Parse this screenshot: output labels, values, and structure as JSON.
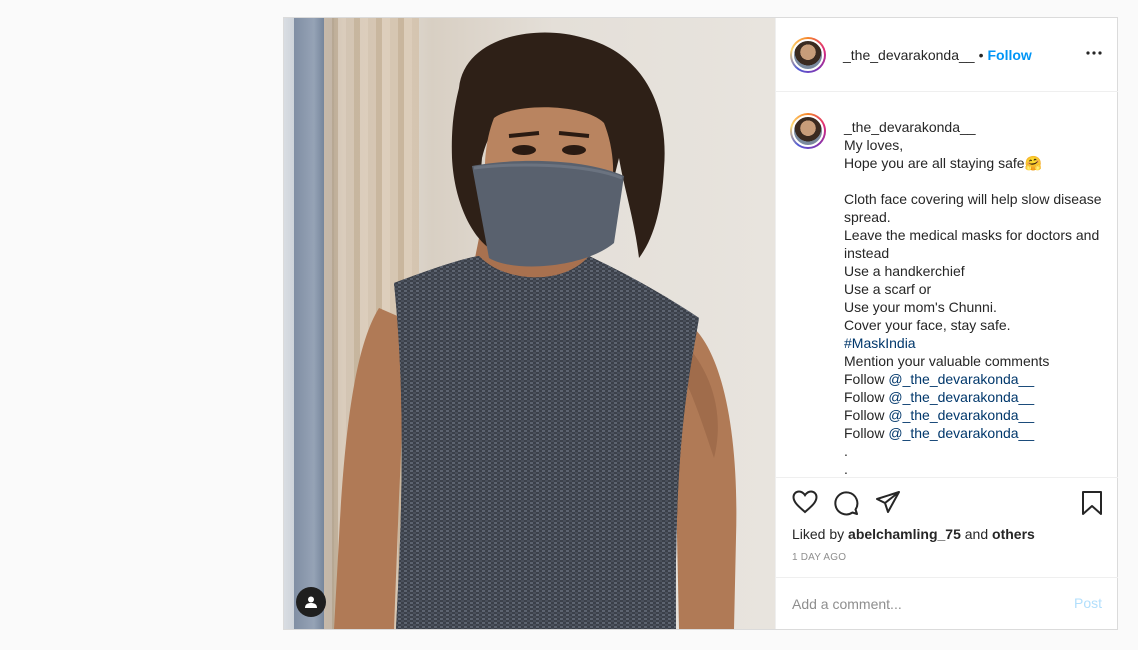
{
  "header": {
    "username": "_the_devarakonda__",
    "separator": "•",
    "follow_label": "Follow",
    "more_icon": "more-horizontal-icon"
  },
  "caption": {
    "username": "_the_devarakonda__",
    "lines": [
      "My loves,",
      "Hope you are all staying safe",
      "",
      "Cloth face covering will help slow disease spread.",
      "Leave the medical masks for doctors and instead",
      "Use a handkerchief",
      "Use a scarf or",
      "Use your mom's Chunni.",
      "Cover your face, stay safe."
    ],
    "emoji": "🤗",
    "hashtag": "#MaskIndia",
    "mention_prompt": "Mention your valuable comments",
    "follow_prefix": "Follow ",
    "follow_mention": "@_the_devarakonda__",
    "dots": "."
  },
  "actions": {
    "icons": [
      "heart-icon",
      "comment-icon",
      "share-icon",
      "bookmark-icon"
    ],
    "liked_prefix": "Liked by ",
    "liked_user": "abelchamling_75",
    "liked_and": " and ",
    "liked_others": "others",
    "timestamp": "1 DAY AGO"
  },
  "comment": {
    "placeholder": "Add a comment...",
    "post_label": "Post"
  },
  "colors": {
    "accent": "#0095f6",
    "link": "#00376b",
    "muted": "#8e8e8e",
    "post_disabled": "#b2dffc"
  }
}
